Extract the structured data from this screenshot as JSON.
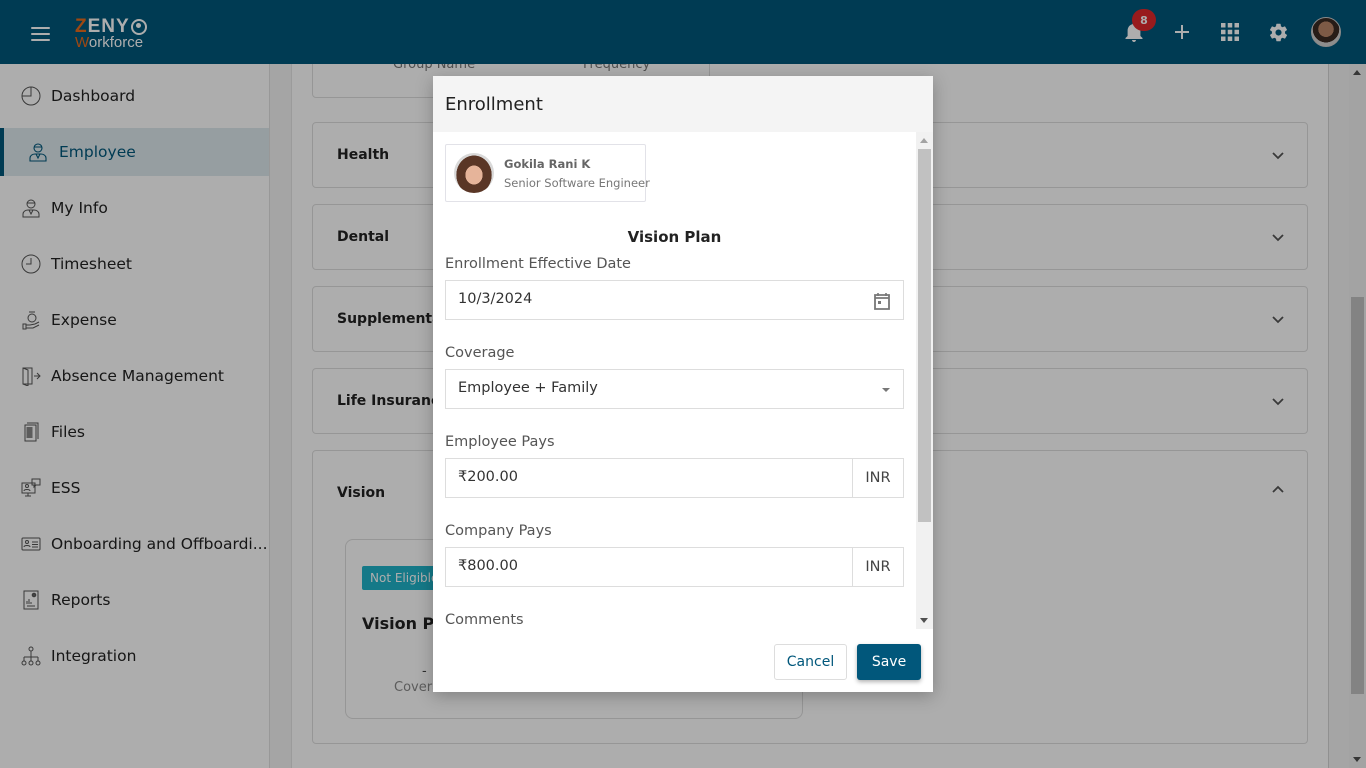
{
  "app": {
    "logo_top_first": "Z",
    "logo_top_rest": "ENY",
    "logo_bottom_first": "W",
    "logo_bottom_rest": "orkforce",
    "notification_count": "8",
    "brand_color": "#01577b",
    "accent_color": "#e86a1b"
  },
  "topbar_icons": [
    "bell-icon",
    "plus-icon",
    "apps-grid-icon",
    "gear-icon",
    "user-avatar"
  ],
  "sidebar": {
    "items": [
      {
        "label": "Dashboard",
        "icon": "dashboard-icon",
        "active": false
      },
      {
        "label": "Employee",
        "icon": "employee-icon",
        "active": true
      },
      {
        "label": "My Info",
        "icon": "my-info-icon",
        "active": false
      },
      {
        "label": "Timesheet",
        "icon": "clock-icon",
        "active": false
      },
      {
        "label": "Expense",
        "icon": "expense-icon",
        "active": false
      },
      {
        "label": "Absence Management",
        "icon": "exit-door-icon",
        "active": false
      },
      {
        "label": "Files",
        "icon": "files-icon",
        "active": false
      },
      {
        "label": "ESS",
        "icon": "ess-icon",
        "active": false
      },
      {
        "label": "Onboarding and Offboardi...",
        "icon": "id-card-icon",
        "active": false
      },
      {
        "label": "Reports",
        "icon": "reports-icon",
        "active": false
      },
      {
        "label": "Integration",
        "icon": "integration-icon",
        "active": false
      }
    ]
  },
  "main": {
    "previous_table_headers": [
      "Group Name",
      "Frequency"
    ],
    "accordions": [
      {
        "title": "Health",
        "expanded": false
      },
      {
        "title": "Dental",
        "expanded": false
      },
      {
        "title": "Supplemental I",
        "expanded": false
      },
      {
        "title": "Life Insurance",
        "expanded": false
      },
      {
        "title": "Vision",
        "expanded": true
      }
    ],
    "vision_card": {
      "badge": "Not Eligible",
      "plan_name": "Vision Pla",
      "dash": "-",
      "coverage_label": "Covera"
    }
  },
  "modal": {
    "title": "Enrollment",
    "employee": {
      "name": "Gokila Rani K",
      "role": "Senior Software Engineer"
    },
    "section_title": "Vision Plan",
    "fields": {
      "effective_date": {
        "label": "Enrollment Effective Date",
        "value": "10/3/2024"
      },
      "coverage": {
        "label": "Coverage",
        "value": "Employee + Family"
      },
      "employee_pays": {
        "label": "Employee Pays",
        "value": "₹200.00",
        "currency": "INR"
      },
      "company_pays": {
        "label": "Company Pays",
        "value": "₹800.00",
        "currency": "INR"
      },
      "comments": {
        "label": "Comments"
      }
    },
    "cancel_label": "Cancel",
    "save_label": "Save"
  }
}
